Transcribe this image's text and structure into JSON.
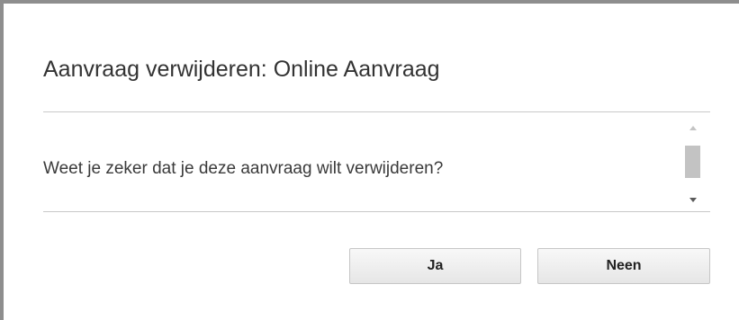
{
  "dialog": {
    "title": "Aanvraag verwijderen: Online Aanvraag",
    "message": "Weet je zeker dat je deze aanvraag wilt verwijderen?",
    "buttons": {
      "yes_label": "Ja",
      "no_label": "Neen"
    }
  },
  "icons": {
    "scroll_up": "scroll-up-arrow-icon",
    "scroll_down": "scroll-down-arrow-icon"
  },
  "colors": {
    "frame": "#8e8e8e",
    "text": "#333333",
    "divider": "#c8c8c8",
    "button_bg": "#eeeeee"
  }
}
